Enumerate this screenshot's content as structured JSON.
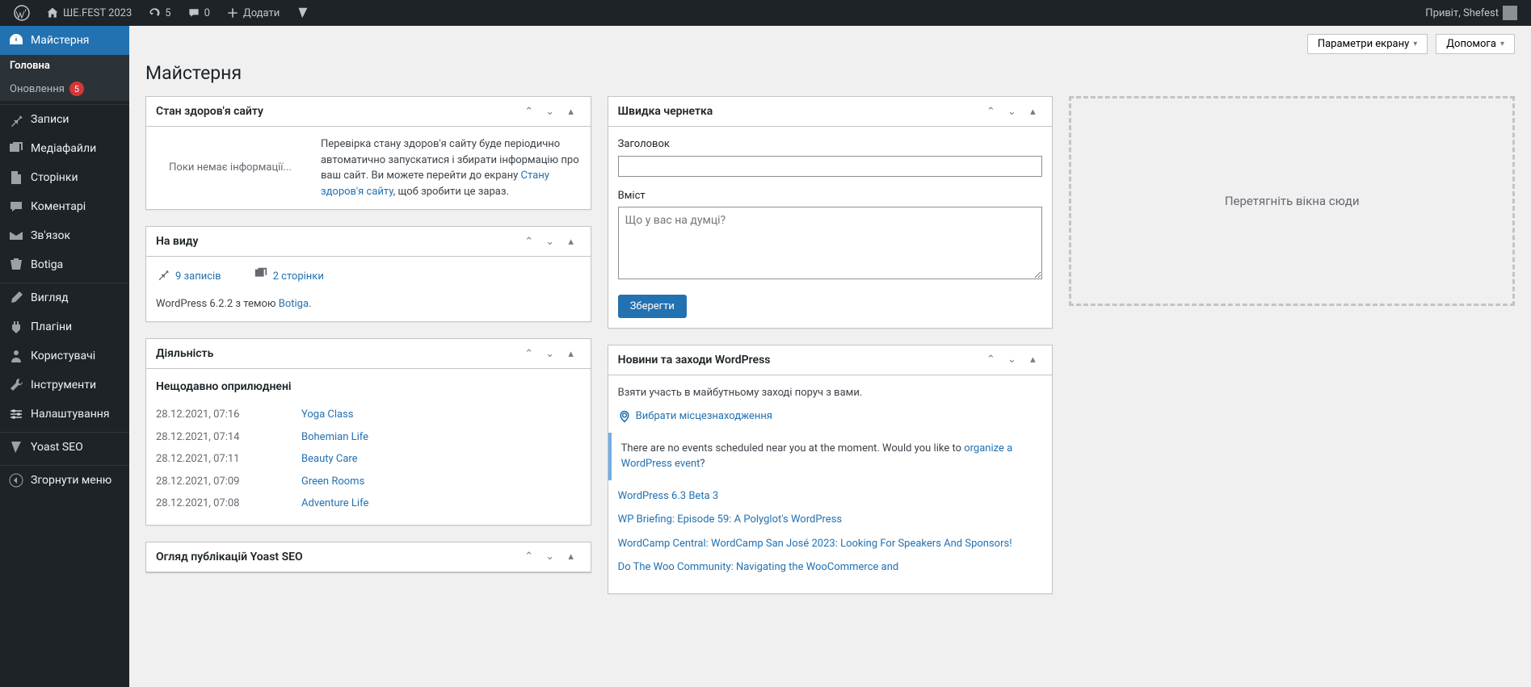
{
  "adminbar": {
    "site_title": "ШЕ.FEST 2023",
    "updates_count": "5",
    "comments_count": "0",
    "add_new": "Додати",
    "greeting": "Привіт, Shefest"
  },
  "sidebar": {
    "dashboard": "Майстерня",
    "home": "Головна",
    "updates": "Оновлення",
    "updates_badge": "5",
    "posts": "Записи",
    "media": "Медіафайли",
    "pages": "Сторінки",
    "comments": "Коментарі",
    "contact": "Зв'язок",
    "botiga": "Botiga",
    "appearance": "Вигляд",
    "plugins": "Плагіни",
    "users": "Користувачі",
    "tools": "Інструменти",
    "settings": "Налаштування",
    "yoast": "Yoast SEO",
    "collapse": "Згорнути меню"
  },
  "header": {
    "screen_options": "Параметри екрану",
    "help": "Допомога",
    "page_title": "Майстерня"
  },
  "health": {
    "title": "Стан здоров'я сайту",
    "no_info": "Поки немає інформації...",
    "desc_part1": "Перевірка стану здоров'я сайту буде періодично автоматично запускатися і збирати інформацію про ваш сайт. Ви можете перейти до екрану ",
    "link": "Стану здоров'я сайту",
    "desc_part2": ", щоб зробити це зараз."
  },
  "glance": {
    "title": "На виду",
    "posts": "9 записів",
    "pages": "2 сторінки",
    "version_prefix": "WordPress 6.2.2 з темою ",
    "theme": "Botiga",
    "version_suffix": "."
  },
  "activity": {
    "title": "Діяльність",
    "recent_heading": "Нещодавно оприлюднені",
    "rows": [
      {
        "date": "28.12.2021, 07:16",
        "title": "Yoga Class"
      },
      {
        "date": "28.12.2021, 07:14",
        "title": "Bohemian Life"
      },
      {
        "date": "28.12.2021, 07:11",
        "title": "Beauty Care"
      },
      {
        "date": "28.12.2021, 07:09",
        "title": "Green Rooms"
      },
      {
        "date": "28.12.2021, 07:08",
        "title": "Adventure Life"
      }
    ]
  },
  "yoast_box": {
    "title": "Огляд публікацій Yoast SEO"
  },
  "draft": {
    "title": "Швидка чернетка",
    "label_title": "Заголовок",
    "label_content": "Вміст",
    "placeholder": "Що у вас на думці?",
    "save": "Зберегти"
  },
  "news": {
    "title": "Новини та заходи WordPress",
    "intro": "Взяти участь в майбутньому заході поруч з вами.",
    "location_link": "Вибрати місцезнаходження",
    "notice_part1": "There are no events scheduled near you at the moment. Would you like to ",
    "notice_link": "organize a WordPress event",
    "notice_part2": "?",
    "items": [
      "WordPress 6.3 Beta 3",
      "WP Briefing: Episode 59: A Polyglot's WordPress",
      "WordCamp Central: WordCamp San José 2023: Looking For Speakers And Sponsors!",
      "Do The Woo Community: Navigating the WooCommerce and"
    ]
  },
  "empty_col": "Перетягніть вікна сюди"
}
